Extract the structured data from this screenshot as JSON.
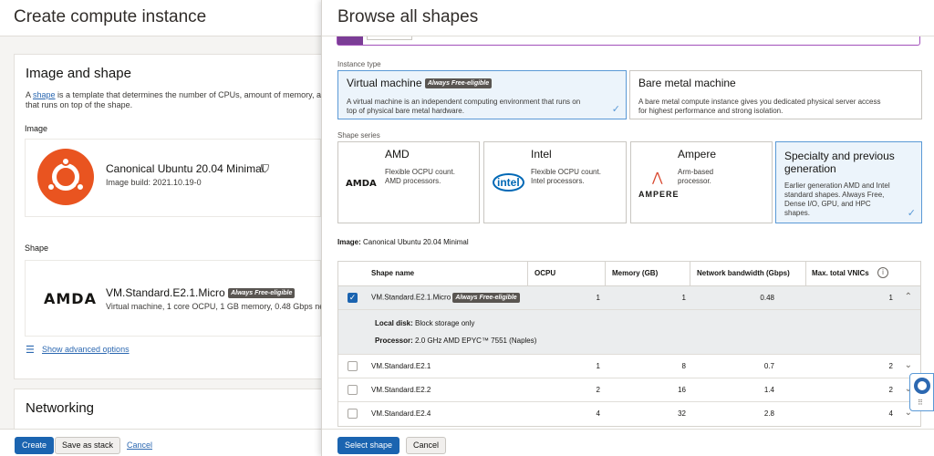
{
  "left": {
    "title": "Create compute instance",
    "image_shape_title": "Image and shape",
    "desc_prefix": "A ",
    "desc_link": "shape",
    "desc_rest": " is a template that determines the number of CPUs, amount of memory, and",
    "desc_line2": "that runs on top of the shape.",
    "image_label": "Image",
    "image_name": "Canonical Ubuntu 20.04 Minimal",
    "image_build": "Image build: 2021.10.19-0",
    "shape_label": "Shape",
    "shape_logo": "AMDA",
    "shape_name": "VM.Standard.E2.1.Micro",
    "shape_badge": "Always Free-eligible",
    "shape_desc": "Virtual machine, 1 core OCPU, 1 GB memory, 0.48 Gbps net",
    "advanced": "Show advanced options",
    "networking_title": "Networking",
    "create_btn": "Create",
    "save_stack_btn": "Save as stack",
    "cancel_link": "Cancel"
  },
  "drawer": {
    "title": "Browse all shapes",
    "instance_type_label": "Instance type",
    "instance_types": [
      {
        "title": "Virtual machine",
        "badge": "Always Free-eligible",
        "desc1": "A virtual machine is an independent computing environment that runs on",
        "desc2": "top of physical bare metal hardware."
      },
      {
        "title": "Bare metal machine",
        "desc1": "A bare metal compute instance gives you dedicated physical server access",
        "desc2": "for highest performance and strong isolation."
      }
    ],
    "shape_series_label": "Shape series",
    "series": [
      {
        "title": "AMD",
        "logo": "AMDA",
        "desc1": "Flexible OCPU count.",
        "desc2": "AMD processors."
      },
      {
        "title": "Intel",
        "logo": "intel",
        "desc1": "Flexible OCPU count.",
        "desc2": "Intel processors."
      },
      {
        "title": "Ampere",
        "logo": "AMPERE",
        "desc1": "Arm-based",
        "desc2": "processor."
      },
      {
        "title1": "Specialty and previous",
        "title2": "generation",
        "desc1": "Earlier generation AMD and Intel",
        "desc2": "standard shapes. Always Free,",
        "desc3": "Dense I/O, GPU, and HPC",
        "desc4": "shapes."
      }
    ],
    "image_key": "Image:",
    "image_val": "Canonical Ubuntu 20.04 Minimal",
    "table": {
      "headers": [
        "Shape name",
        "OCPU",
        "Memory (GB)",
        "Network bandwidth (Gbps)",
        "Max. total VNICs"
      ],
      "rows": [
        {
          "name": "VM.Standard.E2.1.Micro",
          "badge": "Always Free-eligible",
          "ocpu": "1",
          "memory": "1",
          "bw": "0.48",
          "vnics": "1"
        },
        {
          "name": "VM.Standard.E2.1",
          "ocpu": "1",
          "memory": "8",
          "bw": "0.7",
          "vnics": "2"
        },
        {
          "name": "VM.Standard.E2.2",
          "ocpu": "2",
          "memory": "16",
          "bw": "1.4",
          "vnics": "2"
        },
        {
          "name": "VM.Standard.E2.4",
          "ocpu": "4",
          "memory": "32",
          "bw": "2.8",
          "vnics": "4"
        }
      ],
      "detail": {
        "disk_key": "Local disk:",
        "disk_val": "Block storage only",
        "proc_key": "Processor:",
        "proc_val": "2.0 GHz AMD EPYC™ 7551 (Naples)"
      }
    },
    "select_btn": "Select shape",
    "cancel_btn": "Cancel"
  },
  "colors": {
    "primary": "#1b64b0",
    "link": "#2c68b1",
    "selected_border": "#5a99d6",
    "ubuntu": "#e95420",
    "tab_accent": "#7b3d96"
  }
}
